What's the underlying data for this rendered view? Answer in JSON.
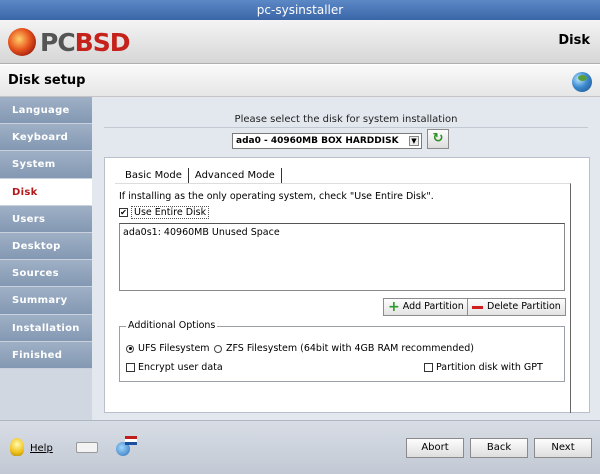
{
  "window": {
    "title": "pc-sysinstaller"
  },
  "banner": {
    "logo_prefix": "PC",
    "logo_suffix": "BSD",
    "step_name": "Disk"
  },
  "section": {
    "title": "Disk setup"
  },
  "sidebar": {
    "items": [
      {
        "label": "Language",
        "active": false
      },
      {
        "label": "Keyboard",
        "active": false
      },
      {
        "label": "System",
        "active": false
      },
      {
        "label": "Disk",
        "active": true
      },
      {
        "label": "Users",
        "active": false
      },
      {
        "label": "Desktop",
        "active": false
      },
      {
        "label": "Sources",
        "active": false
      },
      {
        "label": "Summary",
        "active": false
      },
      {
        "label": "Installation",
        "active": false
      },
      {
        "label": "Finished",
        "active": false
      }
    ]
  },
  "disk": {
    "prompt": "Please select the disk for system installation",
    "selected_disk": "ada0 - 40960MB BOX HARDDISK"
  },
  "tabs": {
    "basic": "Basic Mode",
    "advanced": "Advanced Mode"
  },
  "basic": {
    "hint": "If installing as the only operating system, check \"Use Entire Disk\".",
    "use_entire_disk": "Use Entire Disk",
    "partitions": [
      "ada0s1: 40960MB Unused Space"
    ],
    "add_partition": "Add Partition",
    "delete_partition": "Delete Partition"
  },
  "options": {
    "legend": "Additional Options",
    "ufs": "UFS Filesystem",
    "zfs": "ZFS Filesystem (64bit with 4GB RAM recommended)",
    "encrypt": "Encrypt user data",
    "gpt": "Partition disk with GPT"
  },
  "footer": {
    "help": "Help",
    "abort": "Abort",
    "back": "Back",
    "next": "Next"
  }
}
